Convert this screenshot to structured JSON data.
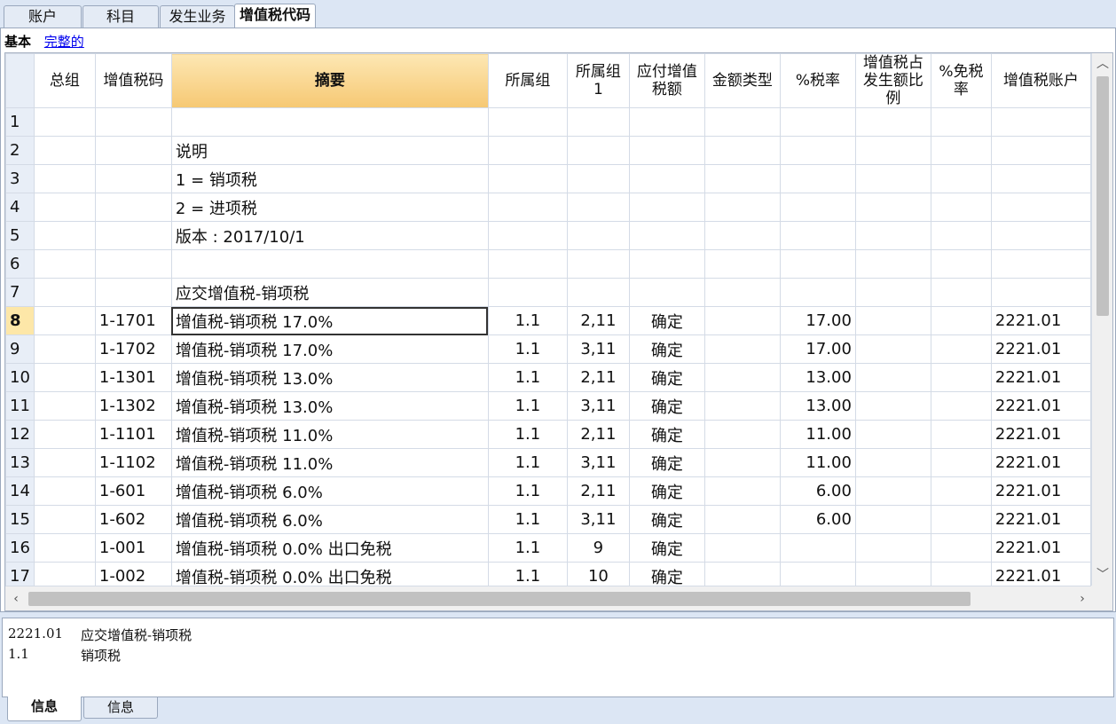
{
  "tabs": [
    "账户",
    "科目",
    "发生业务",
    "增值税代码"
  ],
  "views": {
    "basic": "基本",
    "full": "完整的"
  },
  "columns": [
    "总组",
    "增值税码",
    "摘要",
    "所属组",
    "所属组1",
    "应付增值税额",
    "金额类型",
    "%税率",
    "增值税占发生额比例",
    "%免税率",
    "增值税账户"
  ],
  "rows": [
    {
      "n": "1",
      "cells": [
        "",
        "",
        "",
        "",
        "",
        "",
        "",
        "",
        "",
        "",
        ""
      ]
    },
    {
      "n": "2",
      "cells": [
        "",
        "",
        "说明",
        "",
        "",
        "",
        "",
        "",
        "",
        "",
        ""
      ]
    },
    {
      "n": "3",
      "cells": [
        "",
        "",
        "1 = 销项税",
        "",
        "",
        "",
        "",
        "",
        "",
        "",
        ""
      ]
    },
    {
      "n": "4",
      "cells": [
        "",
        "",
        "2 = 进项税",
        "",
        "",
        "",
        "",
        "",
        "",
        "",
        ""
      ]
    },
    {
      "n": "5",
      "cells": [
        "",
        "",
        "版本 : 2017/10/1",
        "",
        "",
        "",
        "",
        "",
        "",
        "",
        ""
      ]
    },
    {
      "n": "6",
      "cells": [
        "",
        "",
        "",
        "",
        "",
        "",
        "",
        "",
        "",
        "",
        ""
      ]
    },
    {
      "n": "7",
      "cells": [
        "",
        "",
        "应交增值税-销项税",
        "",
        "",
        "",
        "",
        "",
        "",
        "",
        ""
      ]
    },
    {
      "n": "8",
      "cells": [
        "",
        "1-1701",
        "增值税-销项税 17.0%",
        "1.1",
        "2,11",
        "确定",
        "",
        "17.00",
        "",
        "",
        "2221.01"
      ]
    },
    {
      "n": "9",
      "cells": [
        "",
        "1-1702",
        "增值税-销项税 17.0%",
        "1.1",
        "3,11",
        "确定",
        "",
        "17.00",
        "",
        "",
        "2221.01"
      ]
    },
    {
      "n": "10",
      "cells": [
        "",
        "1-1301",
        "增值税-销项税 13.0%",
        "1.1",
        "2,11",
        "确定",
        "",
        "13.00",
        "",
        "",
        "2221.01"
      ]
    },
    {
      "n": "11",
      "cells": [
        "",
        "1-1302",
        "增值税-销项税 13.0%",
        "1.1",
        "3,11",
        "确定",
        "",
        "13.00",
        "",
        "",
        "2221.01"
      ]
    },
    {
      "n": "12",
      "cells": [
        "",
        "1-1101",
        "增值税-销项税 11.0%",
        "1.1",
        "2,11",
        "确定",
        "",
        "11.00",
        "",
        "",
        "2221.01"
      ]
    },
    {
      "n": "13",
      "cells": [
        "",
        "1-1102",
        "增值税-销项税 11.0%",
        "1.1",
        "3,11",
        "确定",
        "",
        "11.00",
        "",
        "",
        "2221.01"
      ]
    },
    {
      "n": "14",
      "cells": [
        "",
        "1-601",
        "增值税-销项税 6.0%",
        "1.1",
        "2,11",
        "确定",
        "",
        "6.00",
        "",
        "",
        "2221.01"
      ]
    },
    {
      "n": "15",
      "cells": [
        "",
        "1-602",
        "增值税-销项税 6.0%",
        "1.1",
        "3,11",
        "确定",
        "",
        "6.00",
        "",
        "",
        "2221.01"
      ]
    },
    {
      "n": "16",
      "cells": [
        "",
        "1-001",
        "增值税-销项税 0.0% 出口免税",
        "1.1",
        "9",
        "确定",
        "",
        "",
        "",
        "",
        "2221.01"
      ]
    },
    {
      "n": "17",
      "cells": [
        "",
        "1-002",
        "增值税-销项税 0.0%  出口免税",
        "1.1",
        "10",
        "确定",
        "",
        "",
        "",
        "",
        "2221.01"
      ]
    }
  ],
  "current_row": "8",
  "info_lines": [
    {
      "code": "2221.01",
      "desc": "应交增值税-销项税"
    },
    {
      "code": "1.1",
      "desc": "销项税"
    }
  ],
  "bottom_tabs": [
    "信息",
    "信息"
  ],
  "scroll_icons": {
    "up": "chevron-up-icon",
    "down": "chevron-down-icon",
    "left": "chevron-left-icon",
    "right": "chevron-right-icon"
  }
}
